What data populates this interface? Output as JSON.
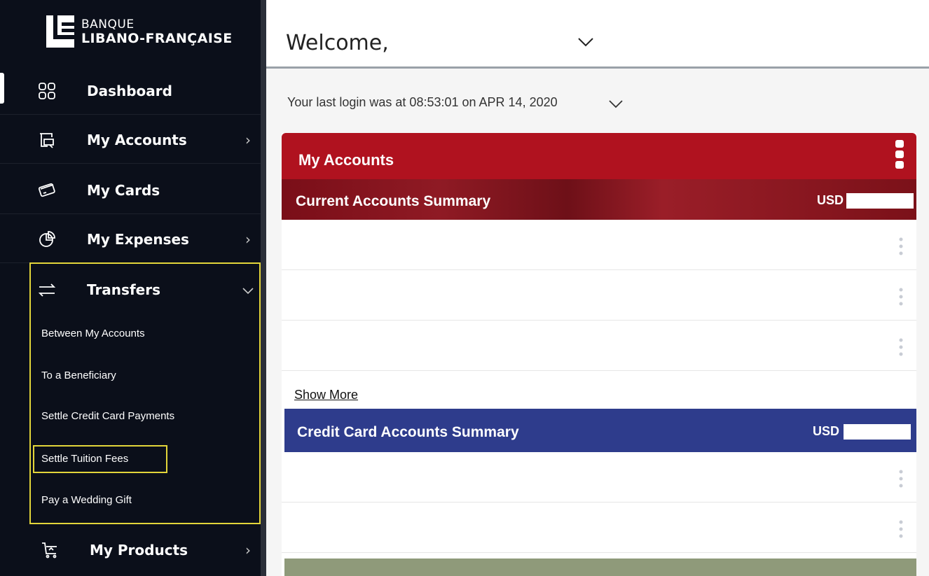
{
  "brand": {
    "line1": "BANQUE",
    "line2": "LIBANO-FRANÇAISE"
  },
  "sidebar": {
    "items": [
      {
        "label": "Dashboard",
        "icon": "grid-icon"
      },
      {
        "label": "My Accounts",
        "icon": "accounts-icon"
      },
      {
        "label": "My Cards",
        "icon": "card-icon"
      },
      {
        "label": "My Expenses",
        "icon": "pie-chart-icon"
      },
      {
        "label": "Transfers",
        "icon": "transfer-arrows-icon"
      },
      {
        "label": "My Products",
        "icon": "cart-icon"
      }
    ],
    "transfers_sub": [
      "Between My Accounts",
      "To a Beneficiary",
      "Settle Credit Card Payments",
      "Settle Tuition Fees",
      "Pay a Wedding Gift"
    ]
  },
  "header": {
    "welcome": "Welcome,"
  },
  "last_login": "Your last login was at 08:53:01 on APR 14, 2020",
  "accounts_card": {
    "title": "My Accounts",
    "current_summary": "Current Accounts Summary",
    "currency": "USD",
    "show_more": "Show More",
    "credit_summary": "Credit Card Accounts Summary",
    "credit_currency": "USD"
  },
  "colors": {
    "sidebar_bg": "#0b0f1a",
    "accounts_red": "#b0121f",
    "credit_blue": "#2e3c8c",
    "highlight_yellow": "#e3d53a"
  }
}
